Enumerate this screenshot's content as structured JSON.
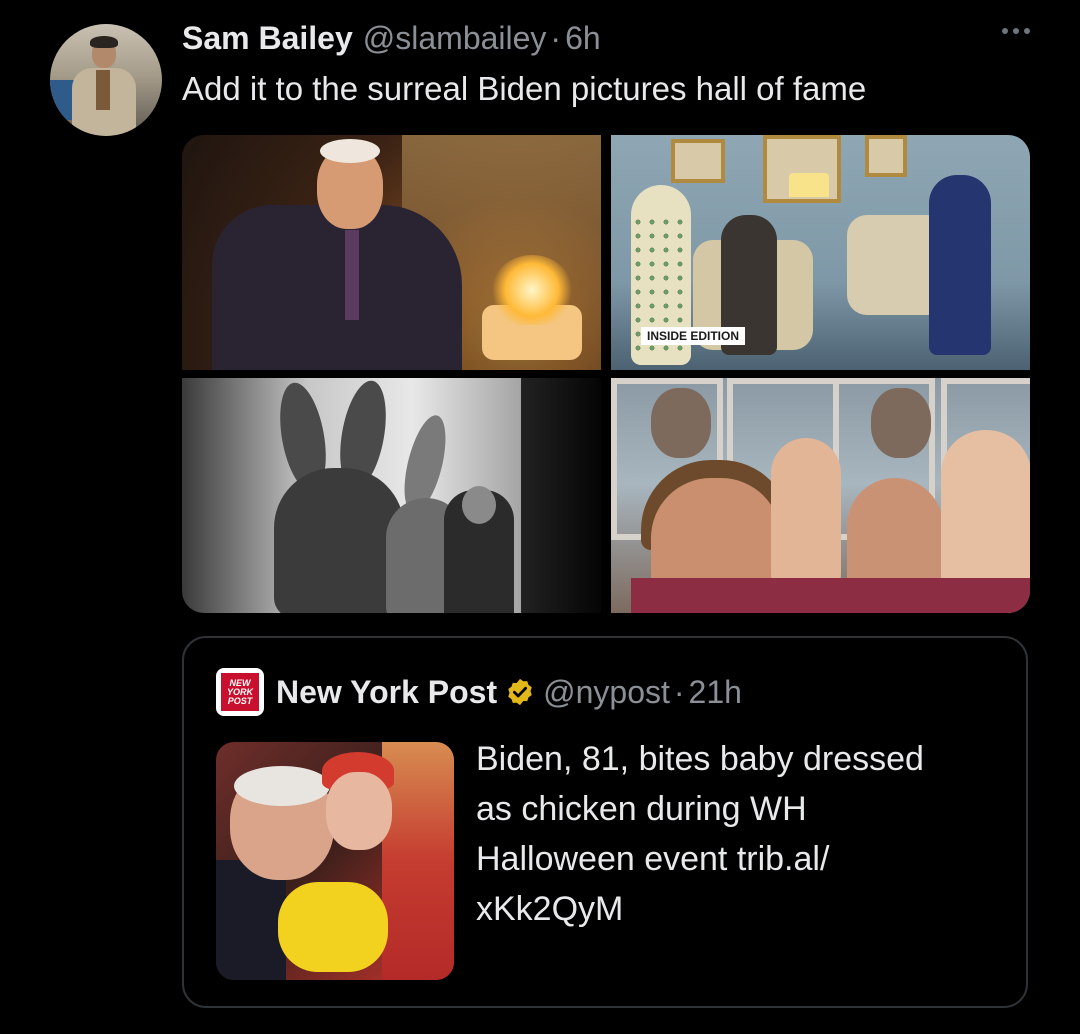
{
  "tweet": {
    "display_name": "Sam Bailey",
    "handle": "@slambailey",
    "separator": "·",
    "time": "6h",
    "text": "Add it to the surreal Biden pictures hall of fame",
    "more_icon": "more-horizontal-icon",
    "media": [
      {
        "description_icon": "photo",
        "badge": ""
      },
      {
        "description_icon": "photo",
        "badge": "INSIDE EDITION"
      },
      {
        "description_icon": "photo",
        "badge": ""
      },
      {
        "description_icon": "photo",
        "badge": ""
      }
    ]
  },
  "quoted_tweet": {
    "logo_text": [
      "NEW",
      "YORK",
      "POST"
    ],
    "display_name": "New York Post",
    "verified_icon": "verified-badge-gold-icon",
    "handle": "@nypost",
    "separator": "·",
    "time": "21h",
    "text": "Biden, 81, bites baby dressed\nas chicken during WH\nHalloween event trib.al/\nxKk2QyM"
  },
  "colors": {
    "background": "#000000",
    "primary_text": "#e7e9ea",
    "secondary_text": "#8b9096",
    "border": "#2f3336",
    "verified_gold": "#e2b719",
    "nypost_red": "#c8102e"
  }
}
